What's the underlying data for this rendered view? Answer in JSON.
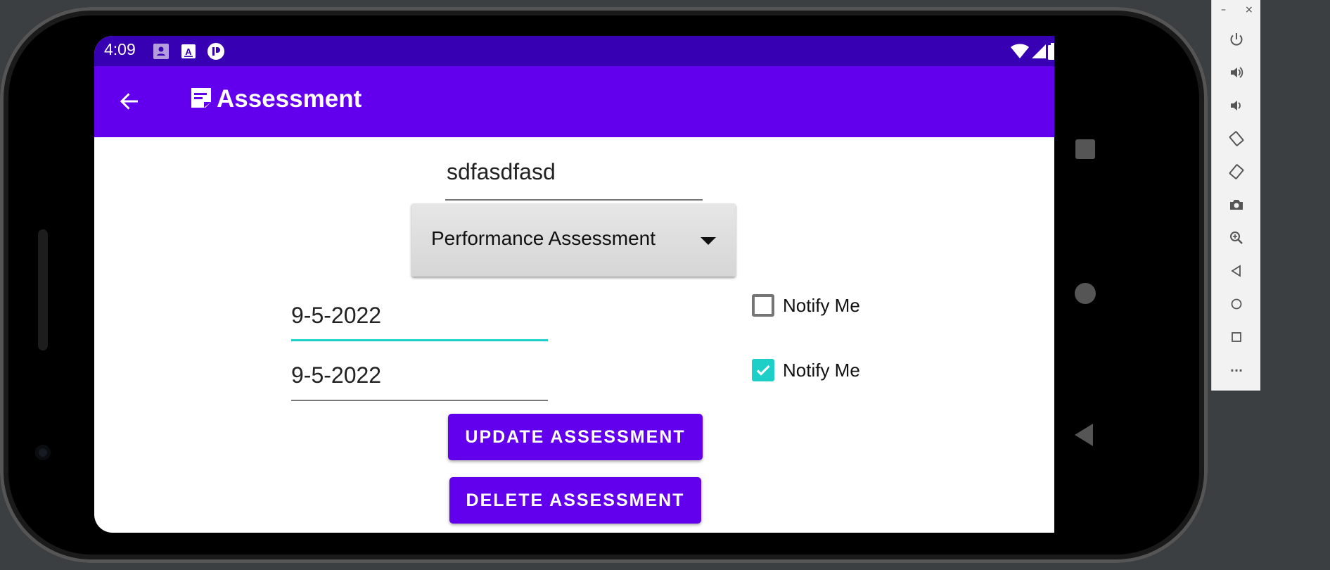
{
  "status_bar": {
    "time": "4:09",
    "left_icons": [
      "account-notification-icon",
      "font-a-notification-icon",
      "app-notification-icon"
    ],
    "right_icons": [
      "wifi-icon",
      "signal-icon",
      "battery-icon"
    ]
  },
  "app_bar": {
    "title": "Assessment",
    "title_icon": "note-icon",
    "back_icon": "arrow-back-icon",
    "color": "#6200ee",
    "status_color": "#3700b3"
  },
  "form": {
    "title_value": "sdfasdfasd",
    "type_selected": "Performance Assessment",
    "start_date": "9-5-2022",
    "end_date": "9-5-2022",
    "start_notify_label": "Notify Me",
    "start_notify_checked": false,
    "end_notify_label": "Notify Me",
    "end_notify_checked": true,
    "accent_color": "#1ecfc8"
  },
  "buttons": {
    "update_label": "UPDATE ASSESSMENT",
    "delete_label": "DELETE ASSESSMENT"
  },
  "emulator_toolbar": {
    "minimize": "–",
    "close": "×",
    "tools": [
      "power-icon",
      "volume-up-icon",
      "volume-down-icon",
      "rotate-left-icon",
      "rotate-right-icon",
      "camera-icon",
      "zoom-icon",
      "back-icon",
      "home-icon",
      "overview-icon",
      "more-icon"
    ],
    "more_label": "···"
  }
}
